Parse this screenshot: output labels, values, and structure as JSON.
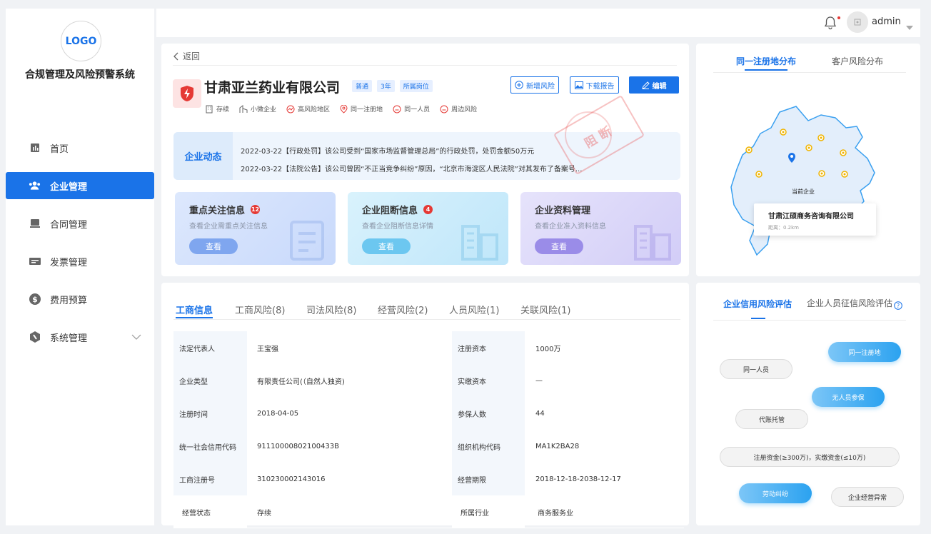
{
  "sidebar": {
    "logo": "LOGO",
    "title": "合规管理及风险预警系统",
    "items": [
      {
        "label": "首页"
      },
      {
        "label": "企业管理"
      },
      {
        "label": "合同管理"
      },
      {
        "label": "发票管理"
      },
      {
        "label": "费用预算"
      },
      {
        "label": "系统管理"
      }
    ]
  },
  "header": {
    "username": "admin"
  },
  "company": {
    "back": "返回",
    "name": "甘肃亚兰药业有限公司",
    "tags": [
      "普通",
      "3年",
      "所属岗位"
    ],
    "buttons": {
      "add_risk": "新增风险",
      "download": "下载报告",
      "edit": "编辑"
    },
    "meta": [
      "存续",
      "小微企业",
      "高风险地区",
      "同一注册地",
      "同一人员",
      "周边风险"
    ],
    "news_title": "企业动态",
    "news": [
      "2022-03-22【行政处罚】该公司受到“国家市场监督管理总局”的行政处罚，处罚金额50万元",
      "2022-03-22【法院公告】该公司曾因“不正当竞争纠纷”原因，“北京市海淀区人民法院”对其发布了备案号..."
    ],
    "stamp": "阻断",
    "panels": [
      {
        "title": "重点关注信息",
        "badge": "12",
        "desc": "查看企业需重点关注信息",
        "button": "查看"
      },
      {
        "title": "企业阻断信息",
        "badge": "4",
        "desc": "查看企业阻断信息详情",
        "button": "查看"
      },
      {
        "title": "企业资料管理",
        "badge": "",
        "desc": "查看企业准入资料信息",
        "button": "查看"
      }
    ]
  },
  "map": {
    "tabs": [
      "同一注册地分布",
      "客户风险分布"
    ],
    "current_label": "当前企业",
    "popup_name": "甘肃江硕商务咨询有限公司",
    "popup_dist": "距离：0.2km"
  },
  "info": {
    "tabs": [
      "工商信息",
      "工商风险(8)",
      "司法风险(8)",
      "经营风险(2)",
      "人员风险(1)",
      "关联风险(1)"
    ],
    "rows": [
      {
        "l1": "法定代表人",
        "v1": "王宝强",
        "l2": "注册资本",
        "v2": "1000万"
      },
      {
        "l1": "企业类型",
        "v1": "有限责任公司(（自然人独资)",
        "l2": "实缴资本",
        "v2": "—"
      },
      {
        "l1": "注册时间",
        "v1": "2018-04-05",
        "l2": "参保人数",
        "v2": "44"
      },
      {
        "l1": "统一社会信用代码",
        "v1": "91110000802100433B",
        "l2": "组织机构代码",
        "v2": "MA1K2BA28"
      },
      {
        "l1": "工商注册号",
        "v1": "310230002143016",
        "l2": "经营期限",
        "v2": "2018-12-18-2038-12-17"
      },
      {
        "l1": "经营状态",
        "v1": "存续",
        "l2": "所属行业",
        "v2": "商务服务业"
      }
    ]
  },
  "risk": {
    "tabs": [
      "企业信用风险评估",
      "企业人员征信风险评估"
    ],
    "pills": [
      "同一注册地",
      "同一人员",
      "无人员参保",
      "代账托管",
      "注册资金(≥300万)，实缴资金(≤10万)",
      "劳动纠纷",
      "企业经营异常"
    ]
  }
}
